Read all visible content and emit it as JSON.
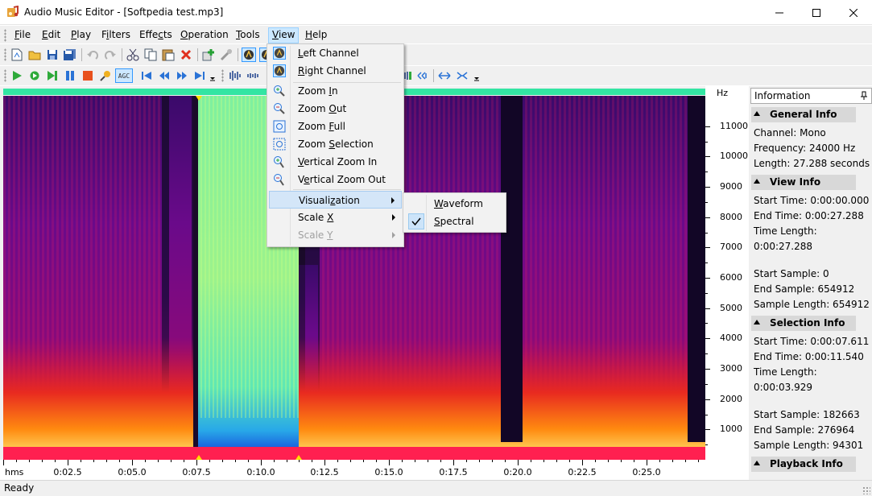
{
  "window": {
    "title": "Audio Music Editor - [Softpedia test.mp3]",
    "controls": [
      "minimize-icon",
      "maximize-icon",
      "close-icon"
    ]
  },
  "menubar": {
    "items": [
      {
        "label": "File",
        "mnemonic": "F"
      },
      {
        "label": "Edit",
        "mnemonic": "E"
      },
      {
        "label": "Play",
        "mnemonic": "P"
      },
      {
        "label": "Filters",
        "mnemonic": "i"
      },
      {
        "label": "Effects",
        "mnemonic": "c"
      },
      {
        "label": "Operation",
        "mnemonic": "O"
      },
      {
        "label": "Tools",
        "mnemonic": "T"
      },
      {
        "label": "View",
        "mnemonic": "V",
        "open": true
      },
      {
        "label": "Help",
        "mnemonic": "H"
      }
    ]
  },
  "toolbar1": {
    "icons": [
      "new-file-icon",
      "open-folder-icon",
      "save-icon",
      "save-all-icon",
      "undo-icon",
      "redo-icon",
      "cut-icon",
      "copy-icon",
      "paste-icon",
      "delete-icon",
      "insert-icon",
      "record-mix-icon",
      "left-channel-icon",
      "right-channel-icon"
    ]
  },
  "toolbar2": {
    "icons": [
      "play-icon",
      "loop-icon",
      "play-to-end-icon",
      "pause-icon",
      "stop-icon",
      "record-mic-icon",
      "agc-icon",
      "go-start-icon",
      "rewind-icon",
      "fast-forward-icon",
      "go-end-icon",
      "toolbar-overflow-icon",
      "waveform-tool-1-icon",
      "waveform-tool-2-icon"
    ],
    "agc_label": "AGC",
    "right_icons": [
      "select-all-icon",
      "rewind-small-icon",
      "zoom-fit-icon",
      "zoom-fit-vertical-icon",
      "toolbar-overflow-2-icon"
    ]
  },
  "view_menu": {
    "items": [
      {
        "label": "Left Channel",
        "icon": "left-channel-icon",
        "mnemonic": "L"
      },
      {
        "label": "Right Channel",
        "icon": "right-channel-icon",
        "mnemonic": "R"
      },
      {
        "separator": true
      },
      {
        "label": "Zoom In",
        "icon": "zoom-in-icon",
        "mnemonic": "I"
      },
      {
        "label": "Zoom Out",
        "icon": "zoom-out-icon",
        "mnemonic": "O"
      },
      {
        "label": "Zoom Full",
        "icon": "zoom-full-icon",
        "mnemonic": "F"
      },
      {
        "label": "Zoom Selection",
        "icon": "zoom-selection-icon",
        "mnemonic": "S"
      },
      {
        "label": "Vertical Zoom In",
        "icon": "vertical-zoom-in-icon",
        "mnemonic": "V"
      },
      {
        "label": "Vertical Zoom Out",
        "icon": "vertical-zoom-out-icon",
        "mnemonic": "e"
      },
      {
        "separator": true
      },
      {
        "label": "Visualization",
        "submenu": true,
        "highlighted": true,
        "mnemonic": "z"
      },
      {
        "label": "Scale X",
        "submenu": true,
        "mnemonic": "X"
      },
      {
        "label": "Scale Y",
        "submenu": true,
        "disabled": true,
        "mnemonic": "Y"
      }
    ]
  },
  "visualization_submenu": {
    "items": [
      {
        "label": "Waveform",
        "checked": false,
        "mnemonic": "W"
      },
      {
        "label": "Spectral",
        "checked": true,
        "mnemonic": "S"
      }
    ]
  },
  "spectrogram": {
    "frequency_unit": "Hz",
    "frequency_labels": [
      "11000",
      "10000",
      "9000",
      "8000",
      "7000",
      "6000",
      "5000",
      "4000",
      "3000",
      "2000",
      "1000"
    ],
    "time_unit": "hms",
    "time_labels": [
      "0:02.5",
      "0:05.0",
      "0:07.5",
      "0:10.0",
      "0:12.5",
      "0:15.0",
      "0:17.5",
      "0:20.0",
      "0:22.5",
      "0:25.0"
    ],
    "selection": {
      "start_seconds": 7.611,
      "end_seconds": 11.54,
      "total_seconds": 27.288
    },
    "colors": {
      "selection_bar": "#33e5a3",
      "background": "#140820"
    }
  },
  "information_panel": {
    "title": "Information",
    "sections": [
      {
        "title": "General Info",
        "lines": [
          "Channel: Mono",
          "Frequency: 24000 Hz",
          "Length: 27.288 seconds"
        ]
      },
      {
        "title": "View Info",
        "lines": [
          "Start Time: 0:00:00.000",
          "End Time: 0:00:27.288",
          "Time Length:",
          "0:00:27.288",
          "",
          "Start Sample: 0",
          "End Sample: 654912",
          "Sample Length: 654912"
        ]
      },
      {
        "title": "Selection Info",
        "lines": [
          "Start Time: 0:00:07.611",
          "End Time: 0:00:11.540",
          "Time Length:",
          "0:00:03.929",
          "",
          "Start Sample: 182663",
          "End Sample: 276964",
          "Sample Length: 94301"
        ]
      },
      {
        "title": "Playback Info",
        "lines": []
      }
    ]
  },
  "statusbar": {
    "text": "Ready"
  }
}
